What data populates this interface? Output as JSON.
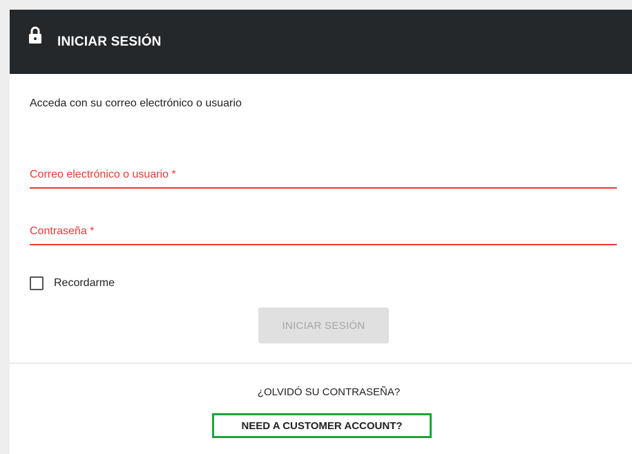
{
  "header": {
    "icon": "lock-icon",
    "title": "INICIAR SESIÓN",
    "background": "#25282b"
  },
  "form": {
    "subtitle": "Acceda con su correo electrónico o usuario",
    "email": {
      "label": "Correo electrónico o usuario *",
      "value": ""
    },
    "password": {
      "label": "Contraseña *",
      "value": ""
    },
    "remember": {
      "label": "Recordarme",
      "checked": false
    },
    "submit_label": "INICIAR SESIÓN",
    "error_color": "#e53935"
  },
  "footer": {
    "forgot_label": "¿OLVIDÓ SU CONTRASEÑA?",
    "customer_label": "NEED A CUSTOMER ACCOUNT?",
    "highlight_color": "#1aa33a"
  }
}
